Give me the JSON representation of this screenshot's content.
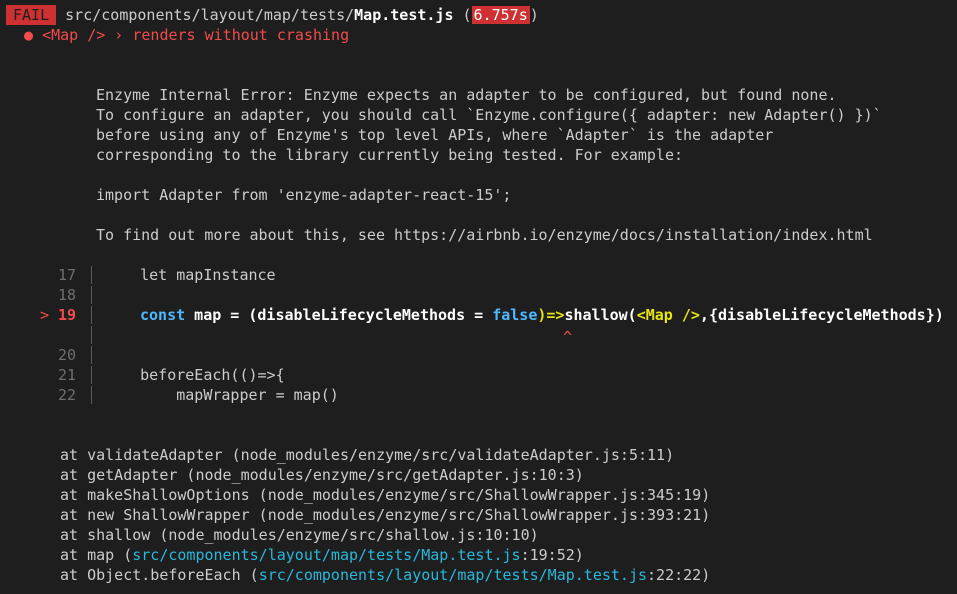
{
  "header": {
    "status_badge": "FAIL",
    "path_dir": "src/components/layout/map/tests/",
    "path_file": "Map.test.js",
    "time_open": " (",
    "time_value": "6.757s",
    "time_close": ")"
  },
  "test": {
    "bullet": "●",
    "title": "<Map /> › renders without crashing"
  },
  "error_message": [
    "Enzyme Internal Error: Enzyme expects an adapter to be configured, but found none.",
    "To configure an adapter, you should call `Enzyme.configure({ adapter: new Adapter() })`",
    "before using any of Enzyme's top level APIs, where `Adapter` is the adapter",
    "corresponding to the library currently being tested. For example:",
    "import Adapter from 'enzyme-adapter-react-15';",
    "To find out more about this, see https://airbnb.io/enzyme/docs/installation/index.html"
  ],
  "code_frame": {
    "marker": ">",
    "caret": "^",
    "lines": [
      {
        "num": "17",
        "text": "    let mapInstance"
      },
      {
        "num": "18",
        "text": ""
      },
      {
        "num": "19",
        "text": ""
      },
      {
        "num": "20",
        "text": ""
      },
      {
        "num": "21",
        "text": "    beforeEach(()=>{"
      },
      {
        "num": "22",
        "text": "        mapWrapper = map()"
      }
    ],
    "highlight": {
      "kw_const": "const",
      "map_name": " map = (disableLifecycleMethods = ",
      "kw_false": "false",
      "arrow": ")=>",
      "shallow": "shallow(",
      "jsx": "<Map />",
      "rest": ",{disableLifecycleMethods})"
    }
  },
  "stack": [
    {
      "prefix": "at validateAdapter (",
      "location": "node_modules/enzyme/src/validateAdapter.js:5:11",
      "suffix": ")"
    },
    {
      "prefix": "at getAdapter (",
      "location": "node_modules/enzyme/src/getAdapter.js:10:3",
      "suffix": ")"
    },
    {
      "prefix": "at makeShallowOptions (",
      "location": "node_modules/enzyme/src/ShallowWrapper.js:345:19",
      "suffix": ")"
    },
    {
      "prefix": "at new ShallowWrapper (",
      "location": "node_modules/enzyme/src/ShallowWrapper.js:393:21",
      "suffix": ")"
    },
    {
      "prefix": "at shallow (",
      "location": "node_modules/enzyme/src/shallow.js:10:10",
      "suffix": ")"
    },
    {
      "prefix": "at map (",
      "link": "src/components/layout/map/tests/Map.test.js",
      "location": ":19:52",
      "suffix": ")"
    },
    {
      "prefix": "at Object.beforeEach (",
      "link": "src/components/layout/map/tests/Map.test.js",
      "location": ":22:22",
      "suffix": ")"
    }
  ]
}
